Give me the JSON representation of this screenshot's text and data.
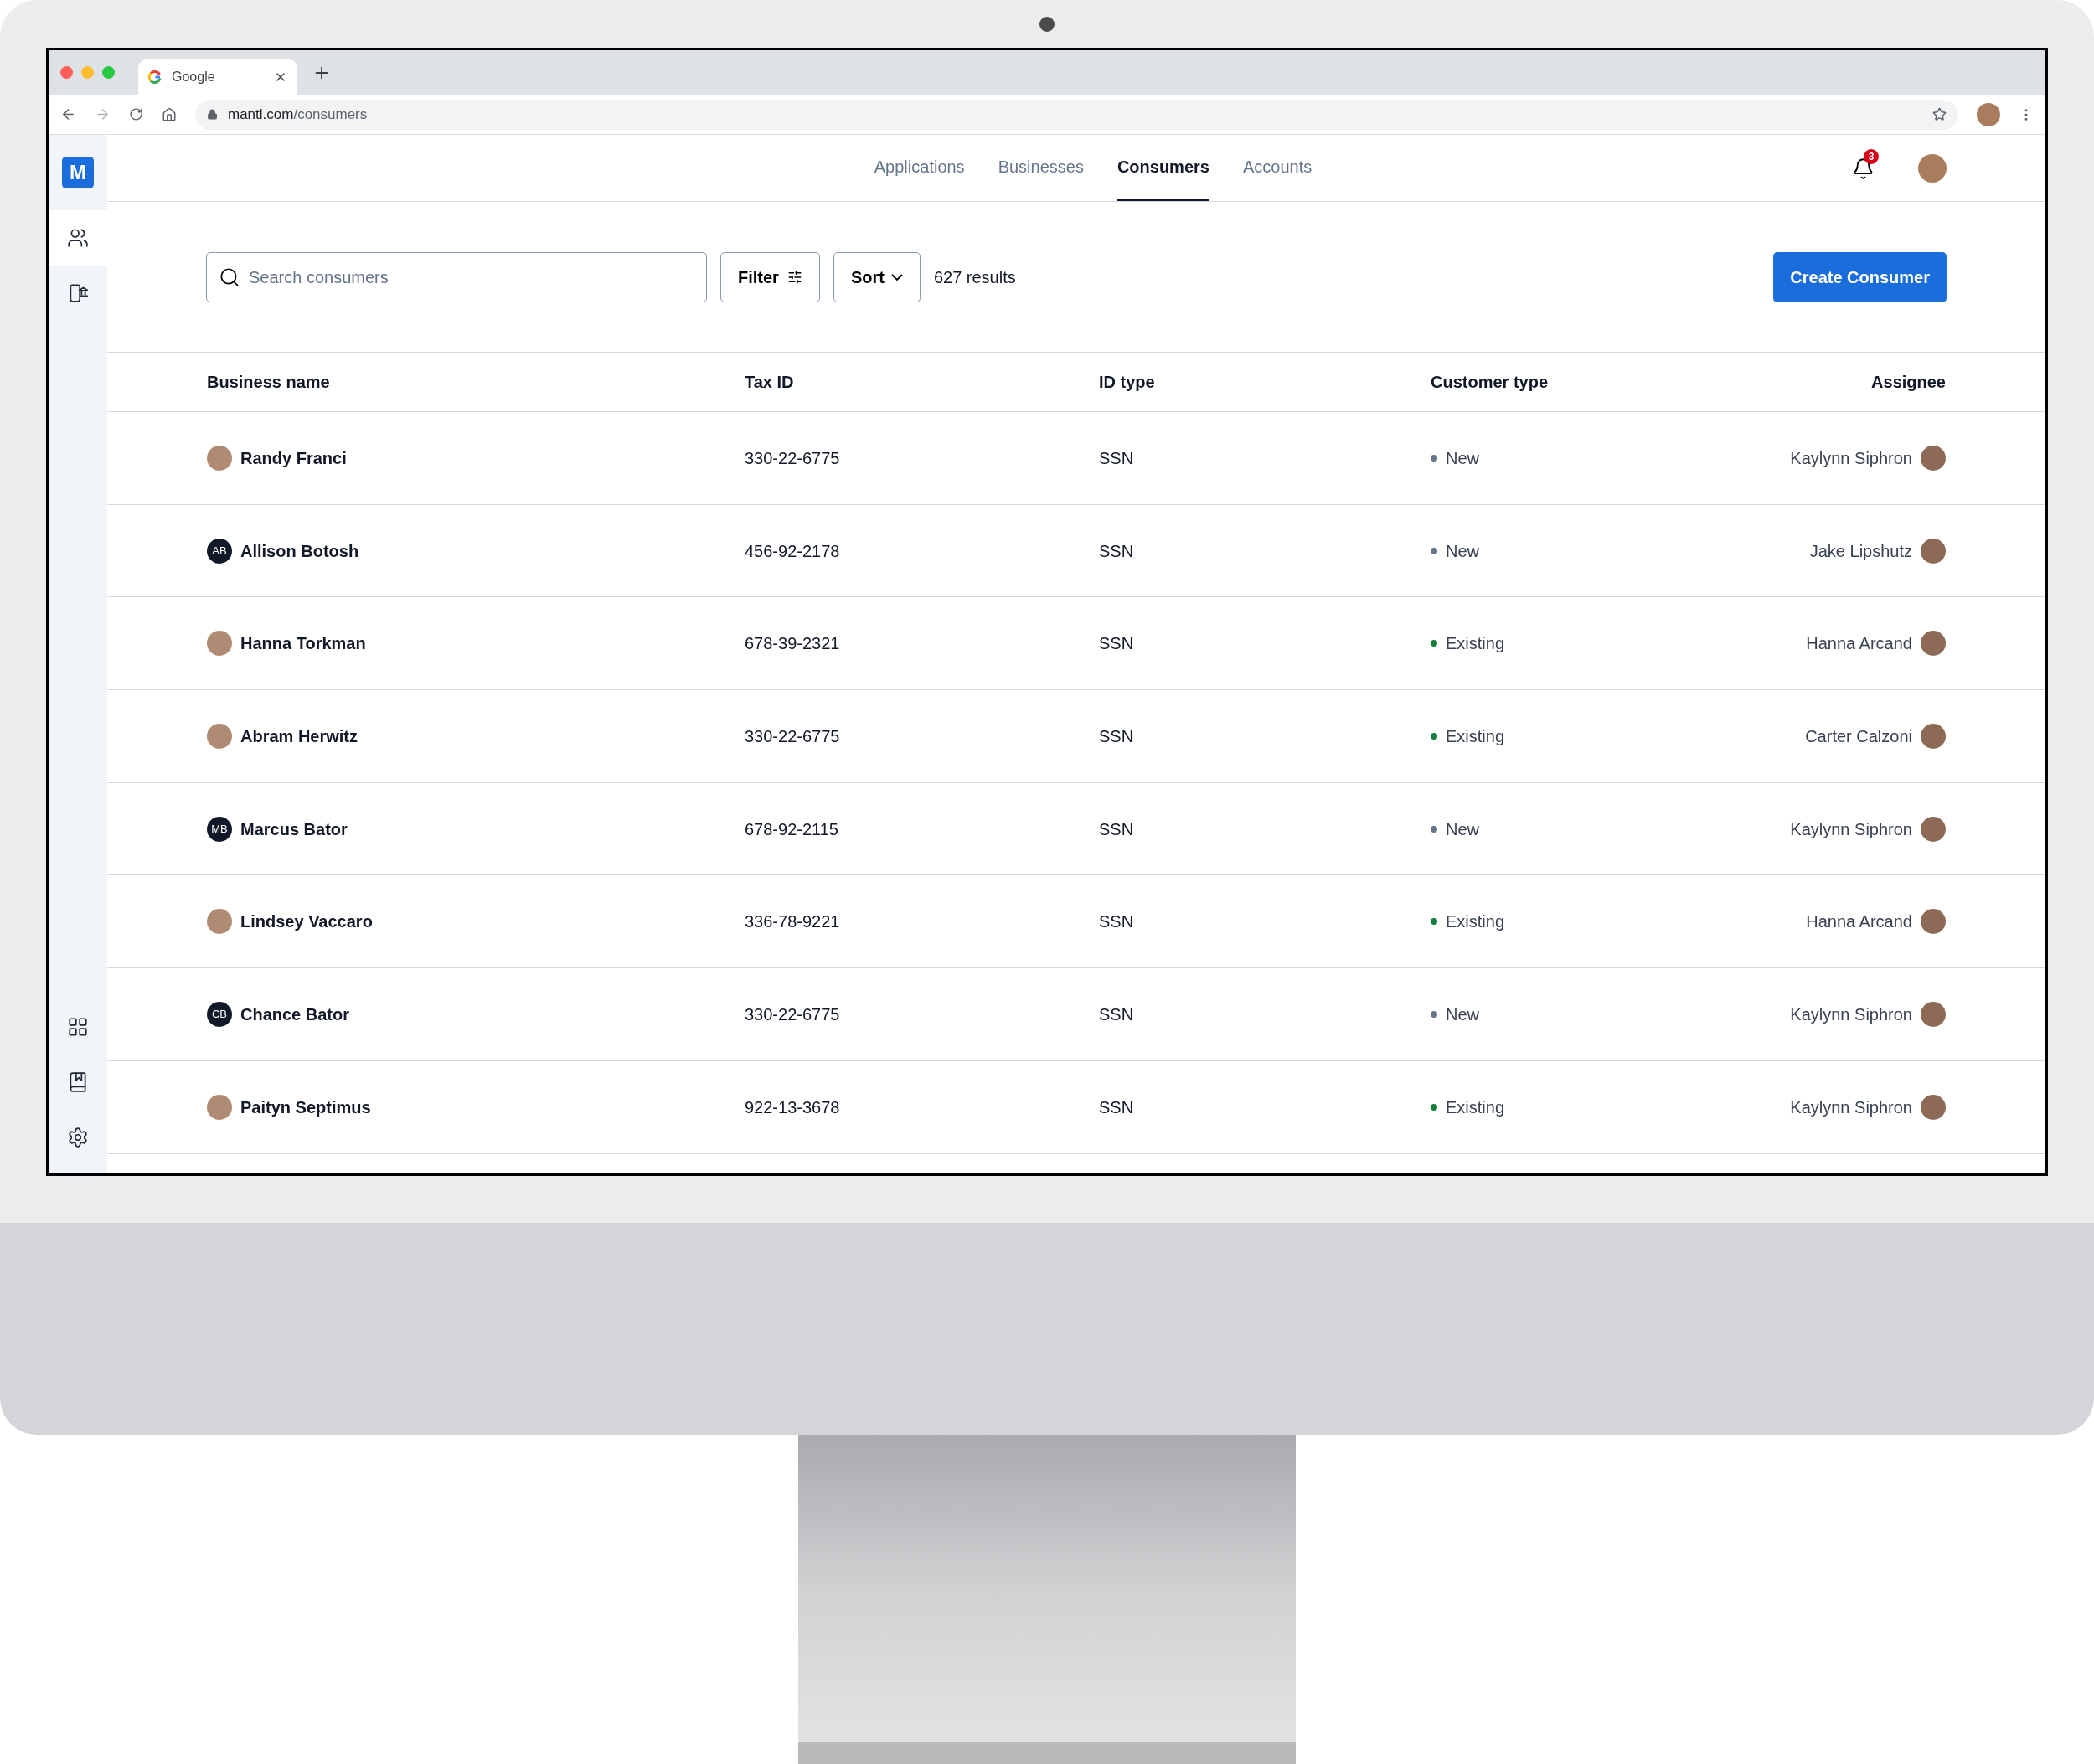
{
  "browser": {
    "tab_title": "Google",
    "url_host": "mantl.com",
    "url_path": "/consumers"
  },
  "app": {
    "logo": "M"
  },
  "sidebar": {
    "top": [
      {
        "kind": "people",
        "selected": true
      },
      {
        "kind": "phone-bank",
        "selected": false
      }
    ],
    "bottom": [
      {
        "kind": "grid",
        "selected": false
      },
      {
        "kind": "book",
        "selected": false
      },
      {
        "kind": "settings",
        "selected": false
      }
    ]
  },
  "nav": {
    "tabs": [
      {
        "label": "Applications",
        "selected": false
      },
      {
        "label": "Businesses",
        "selected": false
      },
      {
        "label": "Consumers",
        "selected": true
      },
      {
        "label": "Accounts",
        "selected": false
      }
    ]
  },
  "notifications": {
    "count": "3"
  },
  "toolbar": {
    "search_placeholder": "Search consumers",
    "filter": "Filter",
    "sort": "Sort",
    "results": "627 results",
    "create": "Create Consumer"
  },
  "table": {
    "columns": [
      "Business name",
      "Tax ID",
      "ID type",
      "Customer type",
      "Assignee"
    ],
    "rows": [
      {
        "name": "Randy Franci",
        "kind": "photo",
        "tax_id": "330-22-6775",
        "id_type": "SSN",
        "customer_type": "New",
        "color": "#64748b",
        "assignee": "Kaylynn Siphron"
      },
      {
        "name": "Allison Botosh",
        "kind": "initials",
        "initials": "AB",
        "tax_id": "456-92-2178",
        "id_type": "SSN",
        "customer_type": "New",
        "color": "#64748b",
        "assignee": "Jake Lipshutz"
      },
      {
        "name": "Hanna Torkman",
        "kind": "photo",
        "tax_id": "678-39-2321",
        "id_type": "SSN",
        "customer_type": "Existing",
        "color": "#15803d",
        "assignee": "Hanna Arcand"
      },
      {
        "name": "Abram Herwitz",
        "kind": "photo",
        "tax_id": "330-22-6775",
        "id_type": "SSN",
        "customer_type": "Existing",
        "color": "#15803d",
        "assignee": "Carter Calzoni"
      },
      {
        "name": "Marcus Bator",
        "kind": "initials",
        "initials": "MB",
        "tax_id": "678-92-2115",
        "id_type": "SSN",
        "customer_type": "New",
        "color": "#64748b",
        "assignee": "Kaylynn Siphron"
      },
      {
        "name": "Lindsey Vaccaro",
        "kind": "photo",
        "tax_id": "336-78-9221",
        "id_type": "SSN",
        "customer_type": "Existing",
        "color": "#15803d",
        "assignee": "Hanna Arcand"
      },
      {
        "name": "Chance Bator",
        "kind": "initials",
        "initials": "CB",
        "tax_id": "330-22-6775",
        "id_type": "SSN",
        "customer_type": "New",
        "color": "#64748b",
        "assignee": "Kaylynn Siphron"
      },
      {
        "name": "Paityn Septimus",
        "kind": "photo",
        "tax_id": "922-13-3678",
        "id_type": "SSN",
        "customer_type": "Existing",
        "color": "#15803d",
        "assignee": "Kaylynn Siphron"
      }
    ]
  }
}
